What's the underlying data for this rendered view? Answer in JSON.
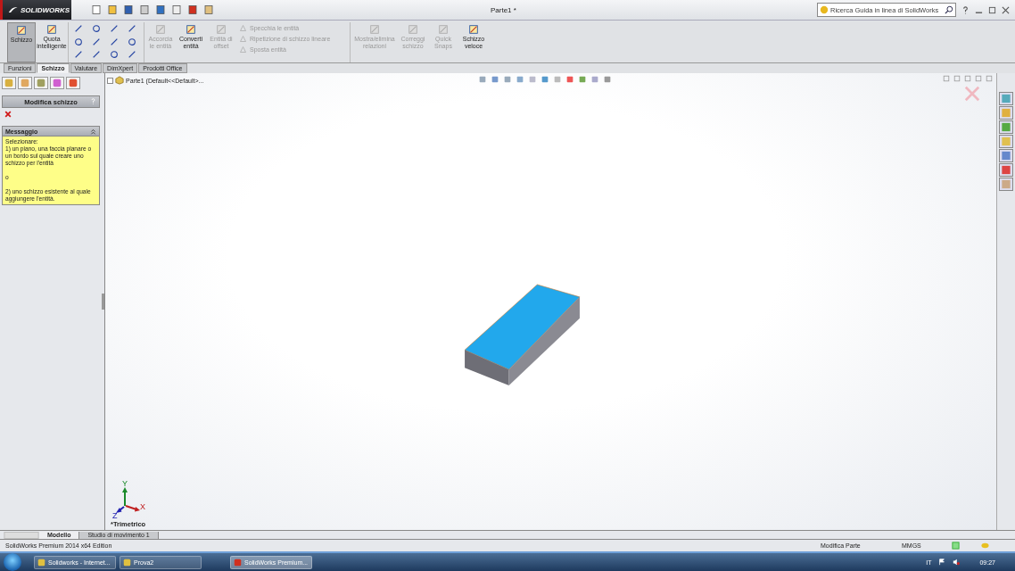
{
  "title_bar": {
    "logo": "SOLIDWORKS",
    "document_title": "Parte1 *",
    "search": {
      "placeholder": "Ricerca Guida in linea di SolidWorks"
    }
  },
  "ribbon": {
    "tools": [
      {
        "label": "Schizzo",
        "kind": "large",
        "selected": true,
        "disabled": false
      },
      {
        "label": "Quota intelligente",
        "kind": "large",
        "selected": false,
        "disabled": false
      },
      {
        "kind": "grid"
      },
      {
        "label": "Accorcia le entità",
        "kind": "large",
        "selected": false,
        "disabled": true
      },
      {
        "label": "Converti entità",
        "kind": "large",
        "selected": false,
        "disabled": false
      },
      {
        "label": "Entità di offset",
        "kind": "large",
        "selected": false,
        "disabled": true
      },
      {
        "kind": "stack"
      },
      {
        "label": "Mostra/elimina relazioni",
        "kind": "large",
        "selected": false,
        "disabled": true
      },
      {
        "label": "Correggi schizzo",
        "kind": "large",
        "selected": false,
        "disabled": true
      },
      {
        "label": "Quick Snaps",
        "kind": "large",
        "selected": false,
        "disabled": true
      },
      {
        "label": "Schizzo veloce",
        "kind": "large",
        "selected": false,
        "disabled": false
      }
    ],
    "stack_items": [
      {
        "label": "Specchia le entità",
        "disabled": true
      },
      {
        "label": "Ripetizione di schizzo lineare",
        "disabled": true
      },
      {
        "label": "Sposta entità",
        "disabled": true
      }
    ]
  },
  "command_tabs": [
    {
      "label": "Funzioni",
      "selected": false
    },
    {
      "label": "Schizzo",
      "selected": true
    },
    {
      "label": "Valutare",
      "selected": false
    },
    {
      "label": "DimXpert",
      "selected": false
    },
    {
      "label": "Prodotti Office",
      "selected": false
    }
  ],
  "property_manager": {
    "title": "Modifica schizzo",
    "message": {
      "header": "Messaggio",
      "paragraphs": [
        "Selezionare:\n1) un piano, una faccia planare o un bordo sul quale creare uno schizzo per l'entità",
        "o",
        "2) uno schizzo esistente al quale aggiungere l'entità."
      ]
    }
  },
  "feature_tree": {
    "root": "Parte1  (Default<<Default>..."
  },
  "viewport": {
    "view_label": "*Trimetrico",
    "axes": [
      "X",
      "Y",
      "Z"
    ]
  },
  "bottom_tabs": [
    {
      "label": "Modello",
      "selected": true
    },
    {
      "label": "Studio di movimento 1",
      "selected": false
    }
  ],
  "status_bar": {
    "edition": "SolidWorks Premium 2014 x64 Edition",
    "mode": "Modifica Parte",
    "units": "MMGS"
  },
  "taskbar": {
    "items": [
      {
        "label": "Solidworks - Internet...",
        "selected": false
      },
      {
        "label": "Prova2",
        "selected": false
      },
      {
        "label": "SolidWorks Premium...",
        "selected": true
      }
    ],
    "language": "IT",
    "clock": "09:27"
  }
}
